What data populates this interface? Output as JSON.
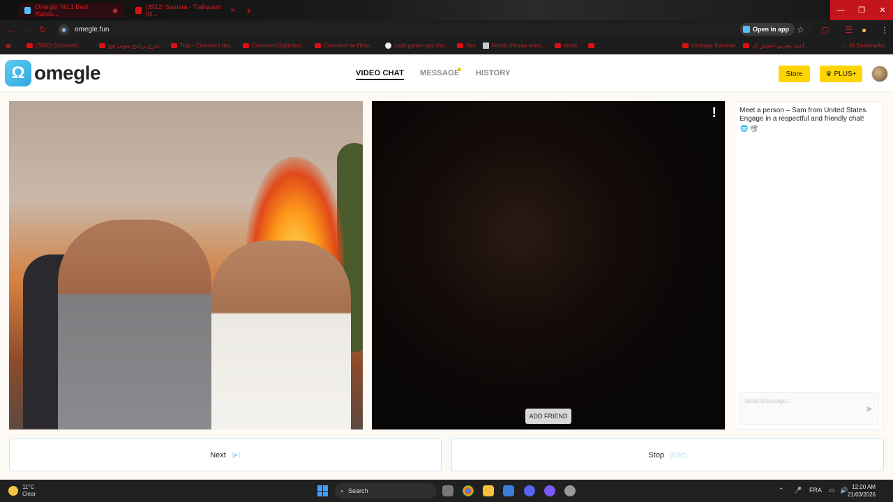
{
  "browser": {
    "tabs": [
      {
        "title": "Omegle: No.1 Best Rando...",
        "active": true
      },
      {
        "title": "(3912) Samara - Trafiquant (O...",
        "active": false
      }
    ],
    "new_tab": "+",
    "url": "omegle.fun",
    "open_in_app": "Open in app",
    "window_controls": [
      "—",
      "❐",
      "✕"
    ],
    "bookmarks": [
      "(3650) Comment...",
      "شرح برنامج سوني فيغ...",
      "Tuto - Comment ren...",
      "Comment Optimiser...",
      "Comment se filmer...",
      "xooti gamer pas che...",
      "Sex",
      "Fonds d'écran anim...",
      "sexbt",
      "...",
      "montage Karsene",
      "أغنية مغربي اطفش ال..."
    ],
    "all_bookmarks": "All Bookmarks"
  },
  "site": {
    "logo_text": "omegle",
    "nav": [
      {
        "label": "VIDEO CHAT",
        "active": true
      },
      {
        "label": "MESSAGE",
        "active": false
      },
      {
        "label": "HISTORY",
        "active": false
      }
    ],
    "store_label": "Store",
    "plus_label": "PLUS+",
    "plus_icon": "crown-icon"
  },
  "video": {
    "report_symbol": "!",
    "add_friend_label": "ADD FRIEND"
  },
  "chat": {
    "intro": "Meet a person – Sam from United States. Engage in a respectful and friendly chat!",
    "intro_icons": "🌐 📽",
    "input_placeholder": "Send Message..."
  },
  "controls": {
    "next_label": "Next",
    "next_hint": "(▶)",
    "stop_label": "Stop",
    "stop_hint": "(ESC)"
  },
  "taskbar": {
    "weather_temp": "11°C",
    "weather_desc": "Clear",
    "search_label": "Search",
    "language": "FRA",
    "time": "12:20 AM",
    "date": "21/03/2026"
  },
  "colors": {
    "accent_yellow": "#ffd400",
    "logo_blue": "#2fa8e0",
    "button_border": "#c6e6f2"
  }
}
